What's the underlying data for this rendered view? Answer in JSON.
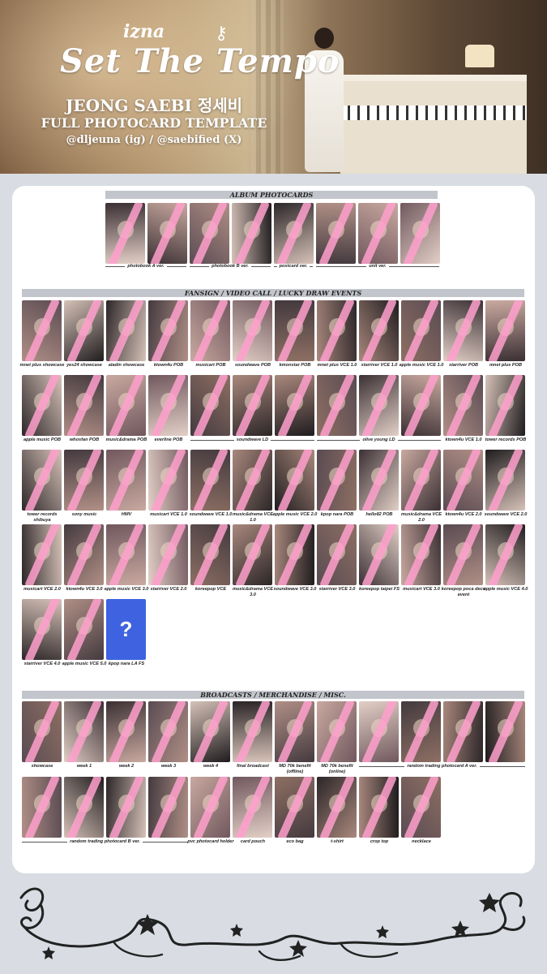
{
  "header": {
    "group": "izna",
    "album": "Set The Tempo",
    "member": "JEONG SAEBI 정세비",
    "subtitle": "FULL PHOTOCARD TEMPLATE",
    "credit": "@dljeuna (ig) / @saebified (X)"
  },
  "sections": {
    "album": "ALBUM PHOTOCARDS",
    "events": "FANSIGN / VIDEO CALL / LUCKY DRAW EVENTS",
    "misc": "BROADCASTS / MERCHANDISE / MISC."
  },
  "album_groups": [
    "photobook A ver.",
    "photobook B ver.",
    "postcard ver.",
    "unit ver."
  ],
  "events": {
    "row1": [
      "mnet plus showcase",
      "yes24 showcase",
      "aladin showcase",
      "ktown4u POB",
      "musicart POB",
      "soundwave POB",
      "kmonstar POB",
      "mnet plus VCE 1.0",
      "starriver VCE 1.0",
      "apple music VCE 1.0",
      "starriver POB",
      "mnet plus POB"
    ],
    "row2": [
      "apple music POB",
      "whosfan POB",
      "music&drama POB",
      "everline POB",
      "soundwave LD",
      "olive young LD",
      "ktown4u VCE 1.0",
      "tower records POB"
    ],
    "row3": [
      "tower records shibuya",
      "sony music",
      "HMV",
      "musicart VCE 1.0",
      "soundwave VCE 1.0",
      "music&drama VCE 1.0",
      "apple music VCE 2.0",
      "kpop nara POB",
      "hello82 POB",
      "music&drama VCE 2.0",
      "ktown4u VCE 2.0",
      "soundwave VCE 2.0"
    ],
    "row4": [
      "musicart VCE 2.0",
      "ktown4u VCE 3.0",
      "apple music VCE 3.0",
      "starriver VCE 2.0",
      "koreepop VCE",
      "music&drama VCE 3.0",
      "soundwave VCE 3.0",
      "starriver VCE 3.0",
      "koreepop taipei FS",
      "musicart VCE 3.0",
      "koreepop poca deco event",
      "apple music VCE 4.0"
    ],
    "row5": [
      "starriver VCE 4.0",
      "apple music VCE 5.0",
      "kpop nara LA FS"
    ],
    "unknown_mark": "?"
  },
  "misc": {
    "row1": [
      "showcase",
      "week 1",
      "week 2",
      "week 3",
      "week 4",
      "final broadcast",
      "MD 70k benefit (offline)",
      "MD 70k benefit (online)"
    ],
    "random_a": "random trading photocard A ver.",
    "random_b": "random trading photocard B ver.",
    "row2": [
      "pvc photocard holder",
      "card pouch",
      "eco bag",
      "t-shirt",
      "crop top",
      "necklace"
    ]
  },
  "colors": {
    "background": "#d9dde3",
    "panel": "#ffffff",
    "section_bar": "#c2c5cb",
    "strike": "#ffa0cd",
    "unknown_card": "#3f63e0"
  }
}
